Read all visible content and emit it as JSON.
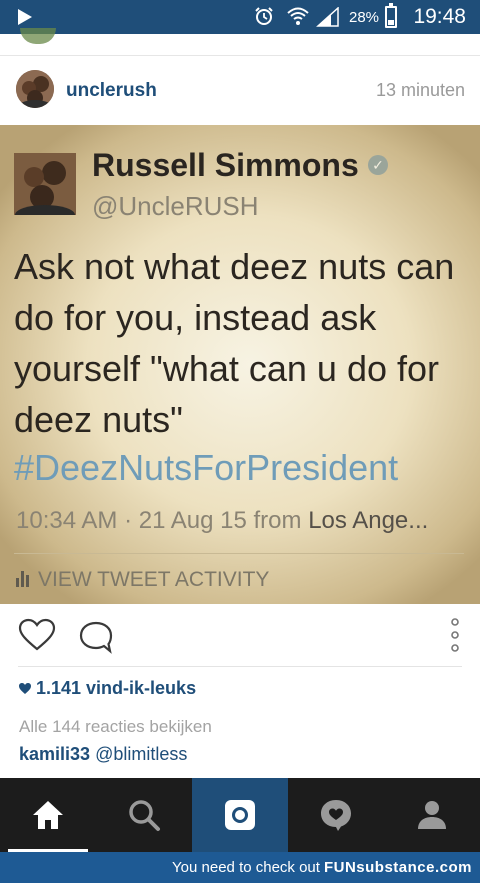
{
  "status_bar": {
    "battery_percent": "28%",
    "time": "19:48",
    "icons": [
      "play-icon",
      "alarm-icon",
      "wifi-icon",
      "signal-icon",
      "battery-icon"
    ]
  },
  "post": {
    "username": "unclerush",
    "time_ago": "13 minuten",
    "tweet": {
      "name": "Russell Simmons",
      "handle": "@UncleRUSH",
      "text": "Ask not what deez nuts can do for you, instead ask yourself \"what can u do for deez nuts\"",
      "hashtag": "#DeezNutsForPresident",
      "timestamp": "10:34 AM · 21 Aug 15 from",
      "location": "Los Ange...",
      "activity_label": "VIEW TWEET ACTIVITY"
    },
    "likes": "1.141 vind-ik-leuks",
    "view_comments": "Alle 144 reacties bekijken",
    "comment": {
      "user": "kamili33",
      "text": "@blimitless"
    }
  },
  "bottom_nav": {
    "items": [
      "home-icon",
      "search-icon",
      "camera-icon",
      "activity-icon",
      "profile-icon"
    ]
  },
  "watermark": {
    "prefix": "You need to check out",
    "brand": "FUNsubstance.com"
  },
  "colors": {
    "brand_blue": "#1f4e79",
    "nav_dark": "#1c1c1c",
    "hashtag": "#6f9cb8"
  }
}
